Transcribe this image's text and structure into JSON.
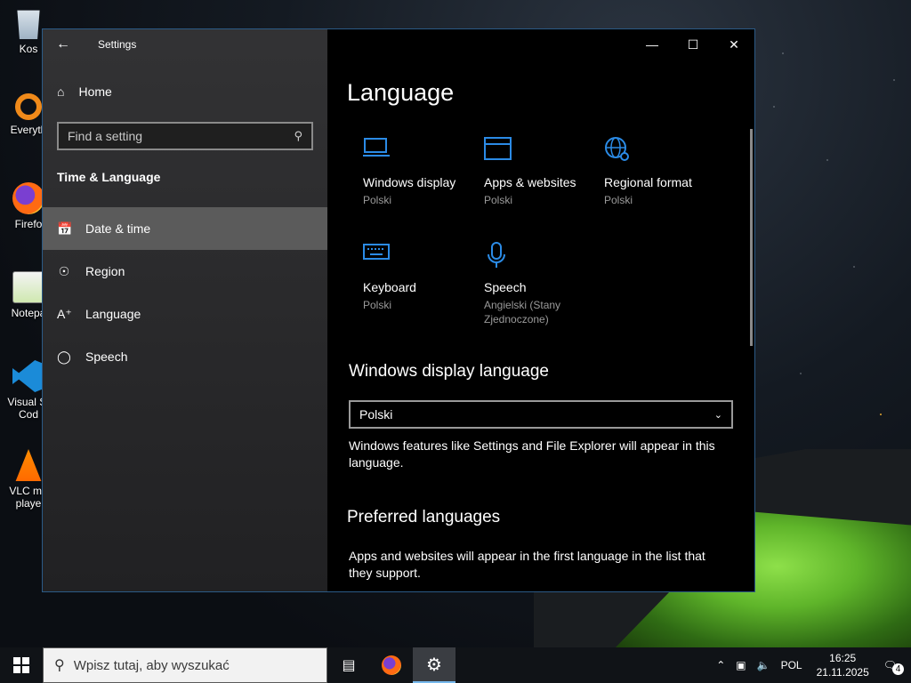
{
  "desktop": {
    "icons": [
      {
        "label": "Kos",
        "icon": "recycle-bin-icon"
      },
      {
        "label": "Everyth",
        "icon": "everything-search-icon"
      },
      {
        "label": "Firefo",
        "icon": "firefox-icon"
      },
      {
        "label": "Notepa",
        "icon": "notepad-plus-plus-icon"
      },
      {
        "label": "Visual St Cod",
        "icon": "vscode-icon"
      },
      {
        "label": "VLC me playe",
        "icon": "vlc-icon"
      }
    ]
  },
  "window": {
    "title": "Settings",
    "controls": {
      "minimize": "—",
      "maximize": "☐",
      "close": "✕"
    }
  },
  "sidebar": {
    "home_label": "Home",
    "search_placeholder": "Find a setting",
    "section_title": "Time & Language",
    "items": [
      {
        "label": "Date & time",
        "icon": "calendar-clock-icon",
        "selected": true
      },
      {
        "label": "Region",
        "icon": "globe-icon",
        "selected": false
      },
      {
        "label": "Language",
        "icon": "language-icon",
        "selected": false
      },
      {
        "label": "Speech",
        "icon": "microphone-icon",
        "selected": false
      }
    ]
  },
  "main": {
    "title": "Language",
    "tiles": [
      {
        "name": "Windows display",
        "sub": "Polski",
        "icon": "monitor-icon"
      },
      {
        "name": "Apps & websites",
        "sub": "Polski",
        "icon": "browser-window-icon"
      },
      {
        "name": "Regional format",
        "sub": "Polski",
        "icon": "globe-settings-icon"
      },
      {
        "name": "Keyboard",
        "sub": "Polski",
        "icon": "keyboard-icon"
      },
      {
        "name": "Speech",
        "sub": "Angielski (Stany Zjednoczone)",
        "icon": "microphone-icon"
      }
    ],
    "display_language": {
      "heading": "Windows display language",
      "selected": "Polski",
      "description": "Windows features like Settings and File Explorer will appear in this language."
    },
    "preferred": {
      "heading": "Preferred languages",
      "description": "Apps and websites will appear in the first language in the list that they support."
    }
  },
  "taskbar": {
    "search_placeholder": "Wpisz tutaj, aby wyszukać",
    "tray": {
      "language": "POL",
      "time": "16:25",
      "date": "21.11.2025",
      "notifications": "4"
    }
  },
  "colors": {
    "accent": "#2b8be6",
    "selected_nav": "#5b5b5b"
  }
}
